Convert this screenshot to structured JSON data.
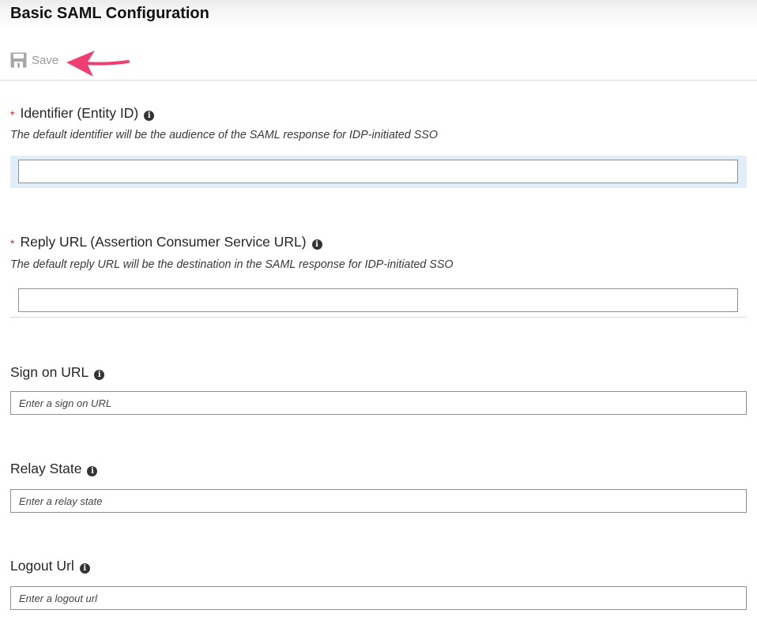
{
  "header": {
    "title": "Basic SAML Configuration"
  },
  "toolbar": {
    "save_label": "Save"
  },
  "fields": {
    "identifier": {
      "label": "Identifier (Entity ID)",
      "required_mark": "*",
      "description": "The default identifier will be the audience of the SAML response for IDP-initiated SSO",
      "value": ""
    },
    "reply_url": {
      "label": "Reply URL (Assertion Consumer Service URL)",
      "required_mark": "*",
      "description": "The default reply URL will be the destination in the SAML response for IDP-initiated SSO",
      "value": ""
    },
    "sign_on_url": {
      "label": "Sign on URL",
      "placeholder": "Enter a sign on URL",
      "value": ""
    },
    "relay_state": {
      "label": "Relay State",
      "placeholder": "Enter a relay state",
      "value": ""
    },
    "logout_url": {
      "label": "Logout Url",
      "placeholder": "Enter a logout url",
      "value": ""
    }
  },
  "info_icon_glyph": "i",
  "colors": {
    "required": "#e02424",
    "annotation_arrow": "#ee3f72",
    "focus_highlight": "#e1eef9",
    "save_disabled": "#9a9a9a"
  }
}
